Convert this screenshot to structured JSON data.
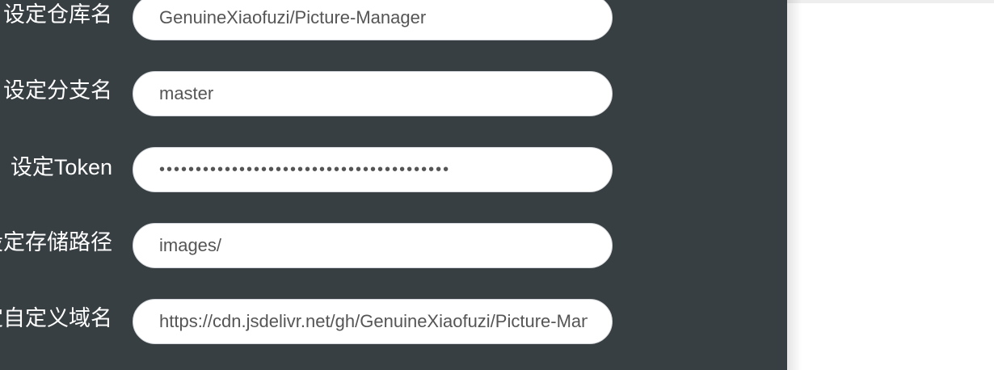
{
  "settings": {
    "fields": [
      {
        "label": "设定仓库名",
        "value": "GenuineXiaofuzi/Picture-Manager"
      },
      {
        "label": "设定分支名",
        "value": "master"
      },
      {
        "label": "设定Token",
        "value": "••••••••••••••••••••••••••••••••••••••••"
      },
      {
        "label": "设定存储路径",
        "value": "images/"
      },
      {
        "label": "设定自定义域名",
        "value": "https://cdn.jsdelivr.net/gh/GenuineXiaofuzi/Picture-Manager"
      }
    ]
  },
  "colors": {
    "panel_bg": "#373f43",
    "input_bg": "#ffffff",
    "label_text": "#ffffff",
    "input_text": "#555555"
  }
}
